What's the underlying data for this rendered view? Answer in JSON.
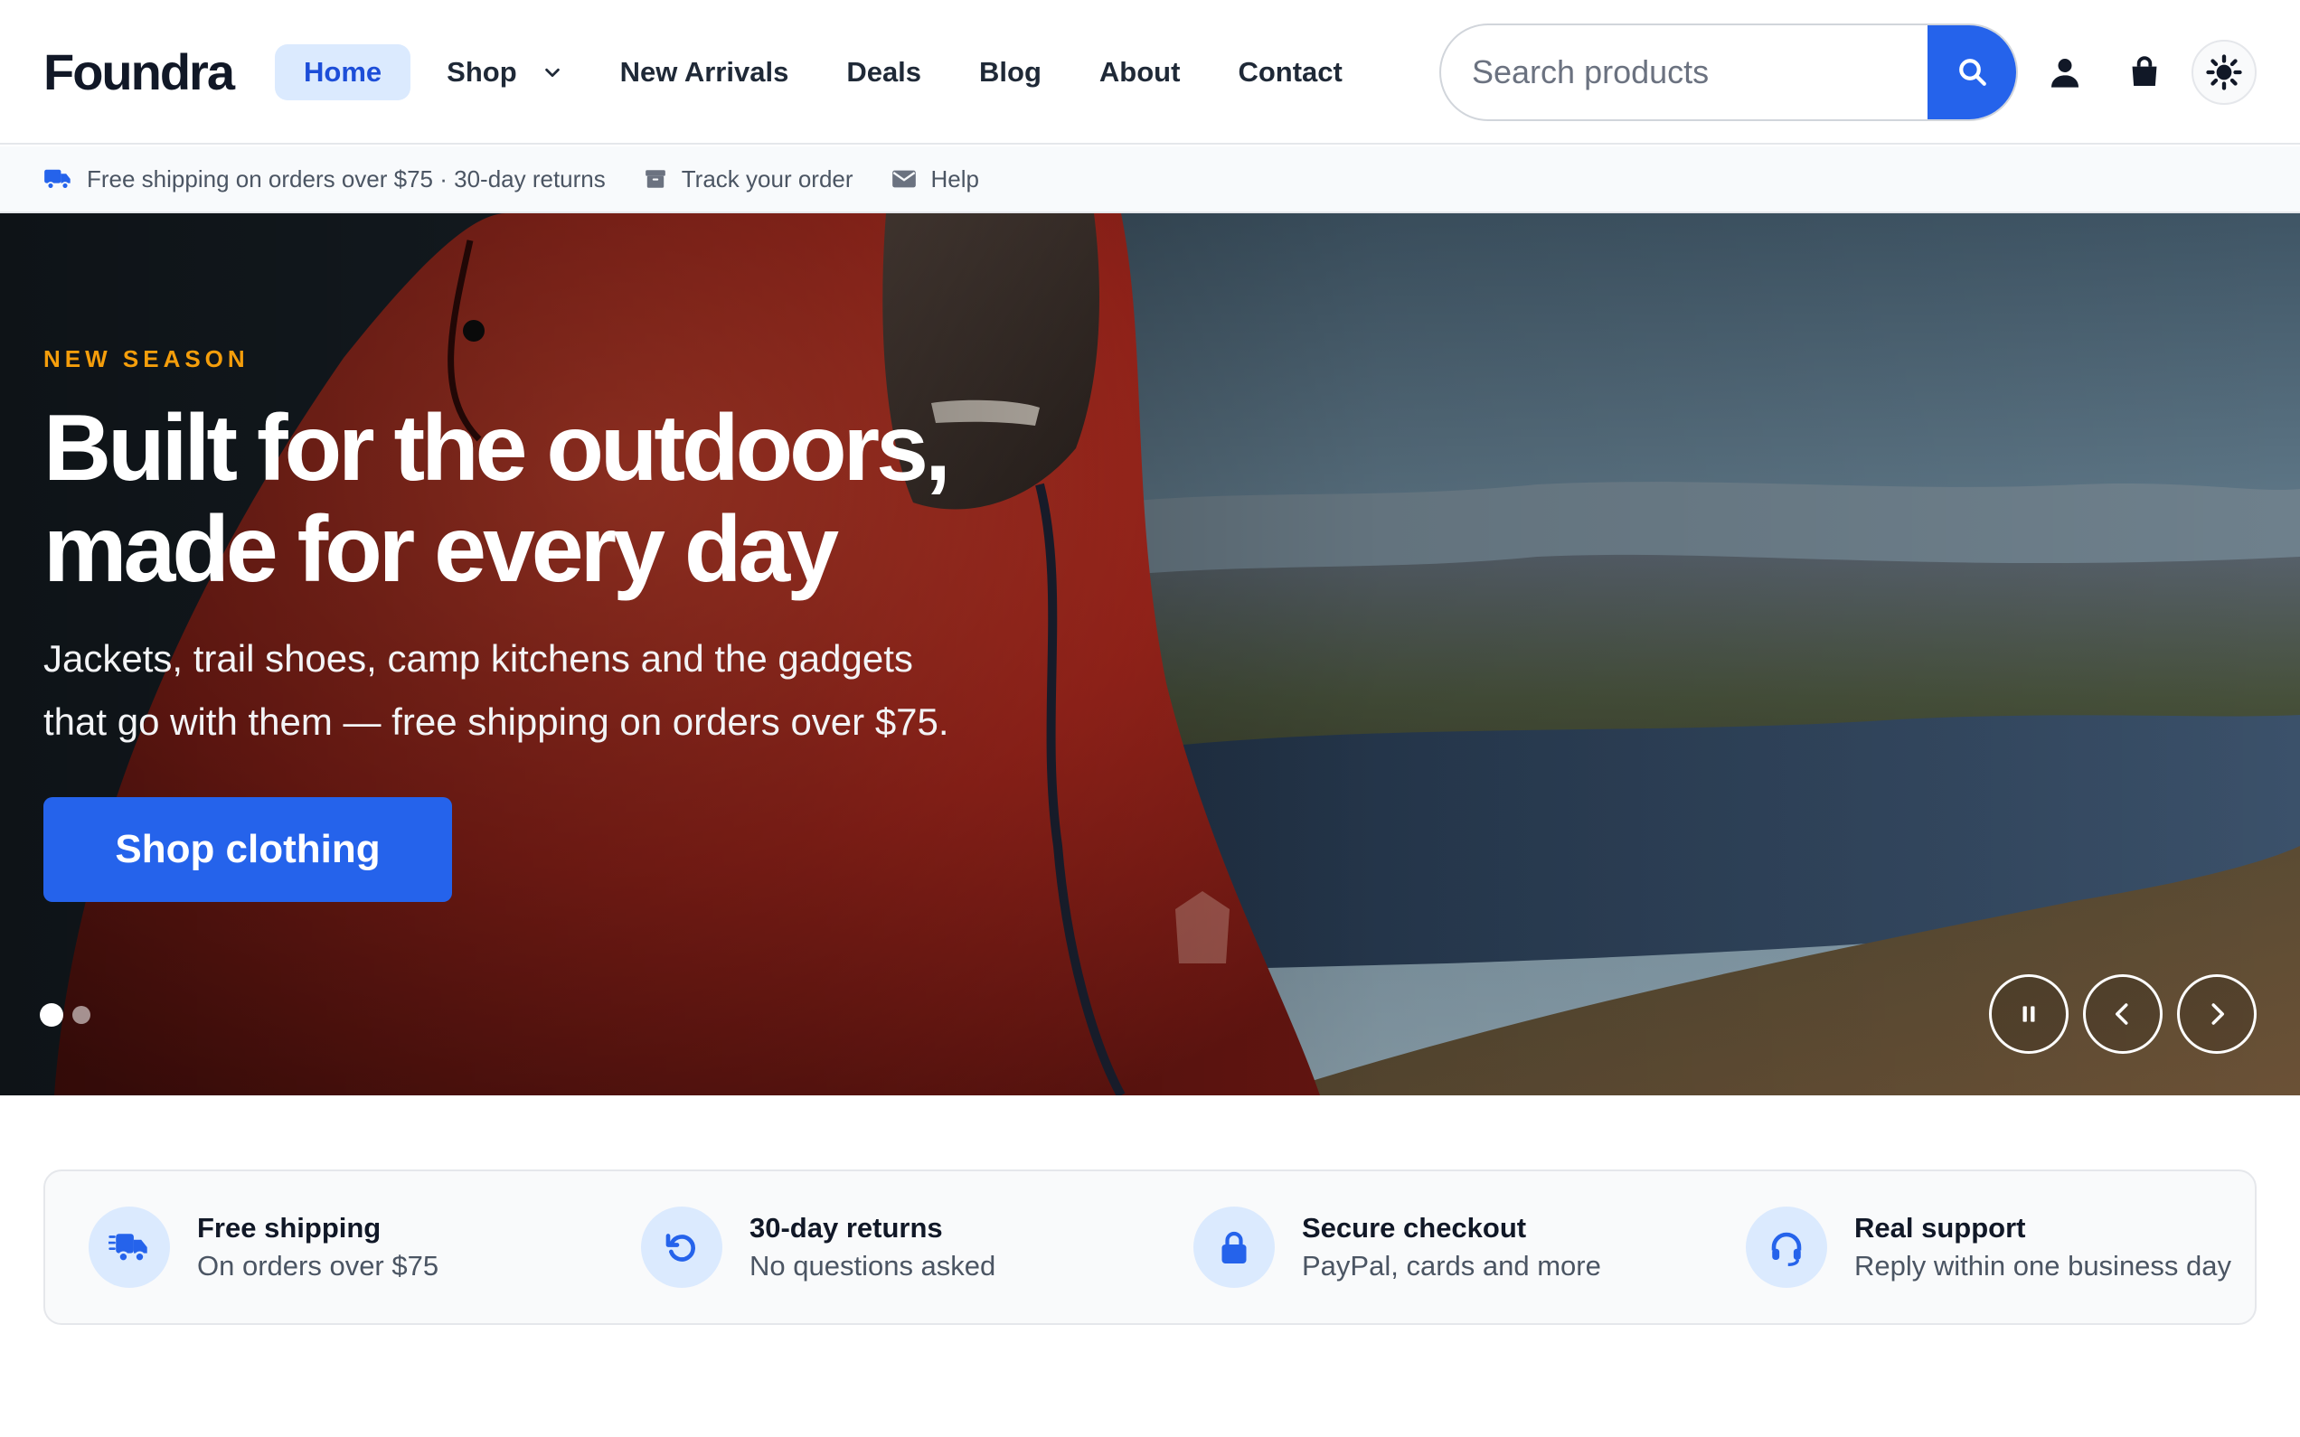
{
  "brand": {
    "logo": "Foundra",
    "accent": "#2563eb",
    "eyebrow_color": "#f59e0b"
  },
  "nav": {
    "items": [
      {
        "label": "Home",
        "active": true
      },
      {
        "label": "Shop",
        "has_dropdown": true
      },
      {
        "label": "New Arrivals"
      },
      {
        "label": "Deals"
      },
      {
        "label": "Blog"
      },
      {
        "label": "About"
      },
      {
        "label": "Contact"
      }
    ]
  },
  "search": {
    "placeholder": "Search products",
    "value": "",
    "button_icon": "search-icon"
  },
  "header_icons": [
    "user-icon",
    "shopping-bag-icon",
    "sun-icon"
  ],
  "utility": {
    "shipping": "Free shipping on orders over $75 · 30-day returns",
    "track": "Track your order",
    "help": "Help"
  },
  "hero": {
    "eyebrow": "NEW SEASON",
    "headline_line1": "Built for the outdoors,",
    "headline_line2": "made for every day",
    "subtext_line1": "Jackets, trail shoes, camp kitchens and the gadgets",
    "subtext_line2": "that go with them — free shipping on orders over $75.",
    "cta": "Shop clothing",
    "slides": 2,
    "active_slide": 1,
    "controls": [
      "pause-icon",
      "chevron-left-icon",
      "chevron-right-icon"
    ]
  },
  "features": [
    {
      "icon": "truck-icon",
      "title": "Free shipping",
      "sub": "On orders over $75"
    },
    {
      "icon": "returns-icon",
      "title": "30-day returns",
      "sub": "No questions asked"
    },
    {
      "icon": "lock-icon",
      "title": "Secure checkout",
      "sub": "PayPal, cards and more"
    },
    {
      "icon": "headset-icon",
      "title": "Real support",
      "sub": "Reply within one business day"
    }
  ]
}
